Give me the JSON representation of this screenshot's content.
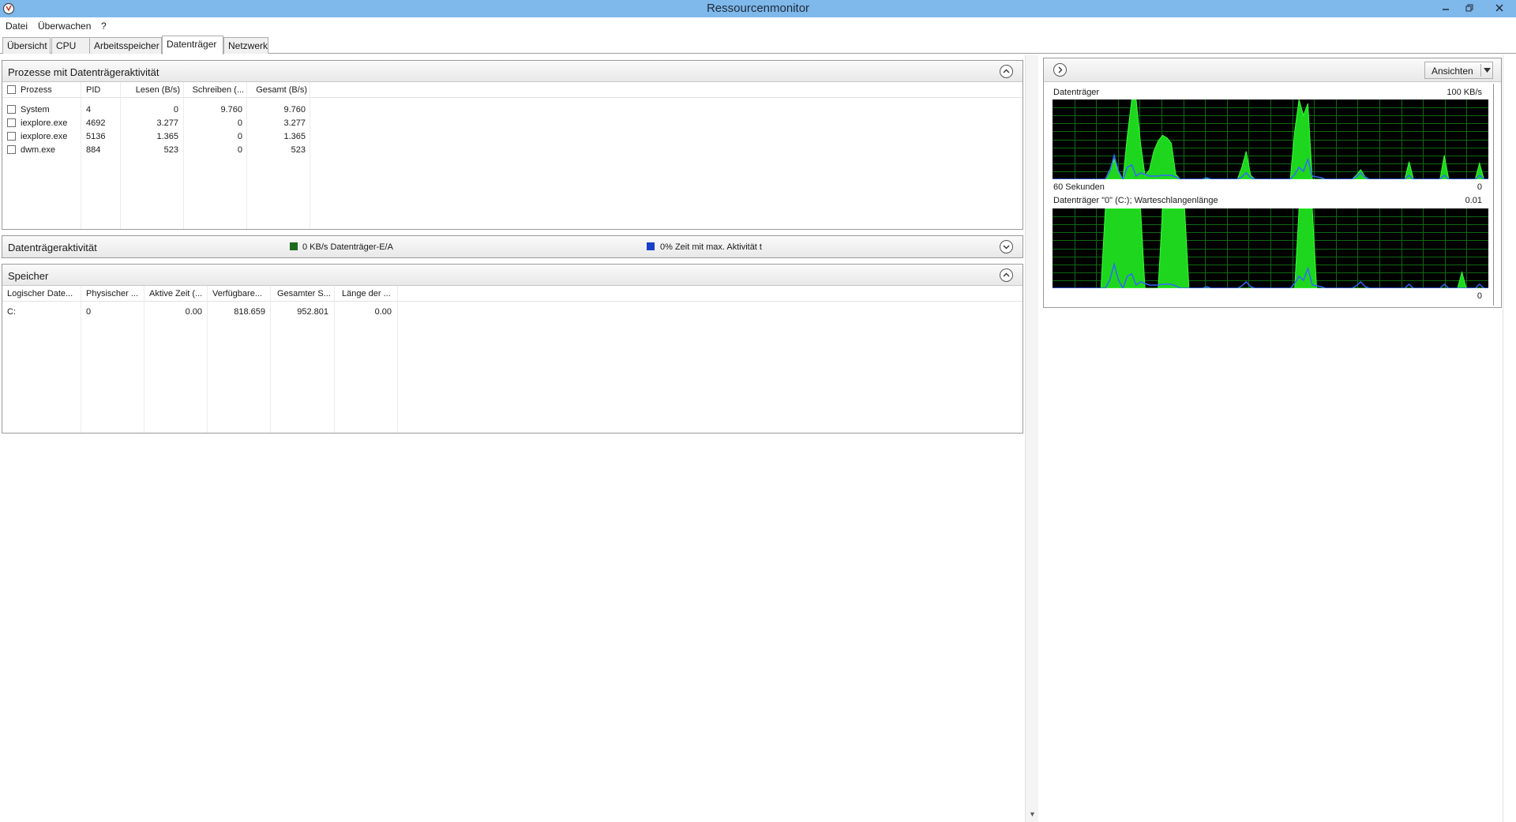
{
  "window": {
    "title": "Ressourcenmonitor"
  },
  "menu": {
    "items": [
      "Datei",
      "Überwachen",
      "?"
    ]
  },
  "tabs": [
    "Übersicht",
    "CPU",
    "Arbeitsspeicher",
    "Datenträger",
    "Netzwerk"
  ],
  "active_tab": "Datenträger",
  "processes": {
    "title": "Prozesse mit Datenträgeraktivität",
    "columns": [
      "Prozess",
      "PID",
      "Lesen (B/s)",
      "Schreiben (...",
      "Gesamt (B/s)"
    ],
    "rows": [
      {
        "name": "System",
        "pid": "4",
        "read": "0",
        "write": "9.760",
        "total": "9.760"
      },
      {
        "name": "iexplore.exe",
        "pid": "4692",
        "read": "3.277",
        "write": "0",
        "total": "3.277"
      },
      {
        "name": "iexplore.exe",
        "pid": "5136",
        "read": "1.365",
        "write": "0",
        "total": "1.365"
      },
      {
        "name": "dwm.exe",
        "pid": "884",
        "read": "523",
        "write": "0",
        "total": "523"
      }
    ]
  },
  "activity": {
    "title": "Datenträgeraktivität",
    "io_label": "0 KB/s Datenträger-E/A",
    "io_color": "#1e6b1e",
    "time_label": "0% Zeit mit max. Aktivität t",
    "time_color": "#1a3fc8"
  },
  "storage": {
    "title": "Speicher",
    "columns": [
      "Logischer Date...",
      "Physischer ...",
      "Aktive Zeit (...",
      "Verfügbare...",
      "Gesamter S...",
      "Länge der ..."
    ],
    "rows": [
      {
        "logical": "C:",
        "physical": "0",
        "active": "0.00",
        "available": "818.659",
        "total": "952.801",
        "queue": "0.00"
      }
    ]
  },
  "graphs": {
    "view_button": "Ansichten",
    "disk": {
      "label": "Datenträger",
      "max_label": "100 KB/s",
      "time_label": "60 Sekunden",
      "min_label": "0",
      "io_series": [
        0,
        0,
        0,
        0,
        0,
        0,
        0,
        0,
        0,
        0,
        0,
        0,
        0,
        12,
        25,
        8,
        0,
        55,
        100,
        100,
        45,
        5,
        12,
        35,
        48,
        55,
        52,
        45,
        6,
        0,
        0,
        0,
        0,
        0,
        0,
        2,
        0,
        0,
        0,
        0,
        0,
        0,
        0,
        15,
        35,
        5,
        0,
        0,
        0,
        0,
        0,
        0,
        0,
        0,
        0,
        60,
        100,
        80,
        95,
        0,
        0,
        0,
        0,
        0,
        0,
        0,
        0,
        0,
        0,
        5,
        12,
        3,
        0,
        0,
        0,
        0,
        0,
        0,
        0,
        0,
        0,
        22,
        0,
        0,
        0,
        0,
        0,
        0,
        0,
        30,
        0,
        0,
        0,
        0,
        0,
        0,
        0,
        20,
        0,
        0
      ],
      "time_series": [
        0,
        0,
        0,
        0,
        0,
        0,
        0,
        0,
        0,
        0,
        0,
        0,
        0,
        10,
        30,
        10,
        0,
        15,
        18,
        4,
        8,
        6,
        4,
        4,
        4,
        5,
        5,
        5,
        3,
        0,
        0,
        0,
        0,
        0,
        0,
        2,
        0,
        0,
        0,
        0,
        0,
        0,
        0,
        3,
        8,
        2,
        0,
        0,
        0,
        0,
        0,
        0,
        0,
        0,
        0,
        6,
        15,
        10,
        25,
        4,
        3,
        2,
        0,
        0,
        0,
        0,
        0,
        0,
        0,
        3,
        8,
        2,
        0,
        0,
        0,
        0,
        0,
        0,
        0,
        0,
        0,
        5,
        0,
        0,
        0,
        0,
        0,
        0,
        0,
        5,
        0,
        0,
        0,
        0,
        0,
        0,
        0,
        5,
        0,
        0
      ]
    },
    "queue": {
      "label": "Datenträger \"0\" (C:); Warteschlangenlänge",
      "max_label": "0.01",
      "min_label": "0",
      "queue_series": [
        0,
        0,
        0,
        0,
        0,
        0,
        0,
        0,
        0,
        0,
        0,
        0,
        100,
        100,
        100,
        100,
        100,
        100,
        100,
        100,
        100,
        0,
        0,
        0,
        0,
        100,
        100,
        100,
        100,
        100,
        100,
        0,
        0,
        0,
        0,
        0,
        0,
        0,
        0,
        0,
        0,
        0,
        0,
        0,
        0,
        0,
        0,
        0,
        0,
        0,
        0,
        0,
        0,
        0,
        0,
        0,
        100,
        100,
        100,
        100,
        0,
        0,
        0,
        0,
        0,
        0,
        0,
        0,
        0,
        0,
        0,
        0,
        0,
        0,
        0,
        0,
        0,
        0,
        0,
        0,
        0,
        0,
        0,
        0,
        0,
        0,
        0,
        0,
        0,
        0,
        0,
        0,
        0,
        20,
        0,
        0,
        0,
        0,
        0,
        0
      ],
      "time_series": [
        0,
        0,
        0,
        0,
        0,
        0,
        0,
        0,
        0,
        0,
        0,
        0,
        0,
        10,
        30,
        10,
        0,
        15,
        18,
        4,
        8,
        6,
        4,
        4,
        4,
        5,
        5,
        5,
        3,
        0,
        0,
        0,
        0,
        0,
        0,
        2,
        0,
        0,
        0,
        0,
        0,
        0,
        0,
        3,
        8,
        2,
        0,
        0,
        0,
        0,
        0,
        0,
        0,
        0,
        0,
        6,
        15,
        10,
        25,
        4,
        3,
        2,
        0,
        0,
        0,
        0,
        0,
        0,
        0,
        3,
        8,
        2,
        0,
        0,
        0,
        0,
        0,
        0,
        0,
        0,
        0,
        5,
        0,
        0,
        0,
        0,
        0,
        0,
        0,
        5,
        0,
        0,
        0,
        0,
        0,
        0,
        0,
        5,
        0,
        0
      ]
    },
    "line_green": "#33ff33",
    "fill_green": "#1ed61e",
    "line_blue": "#3366ff",
    "grid_color": "#0f6a12"
  }
}
